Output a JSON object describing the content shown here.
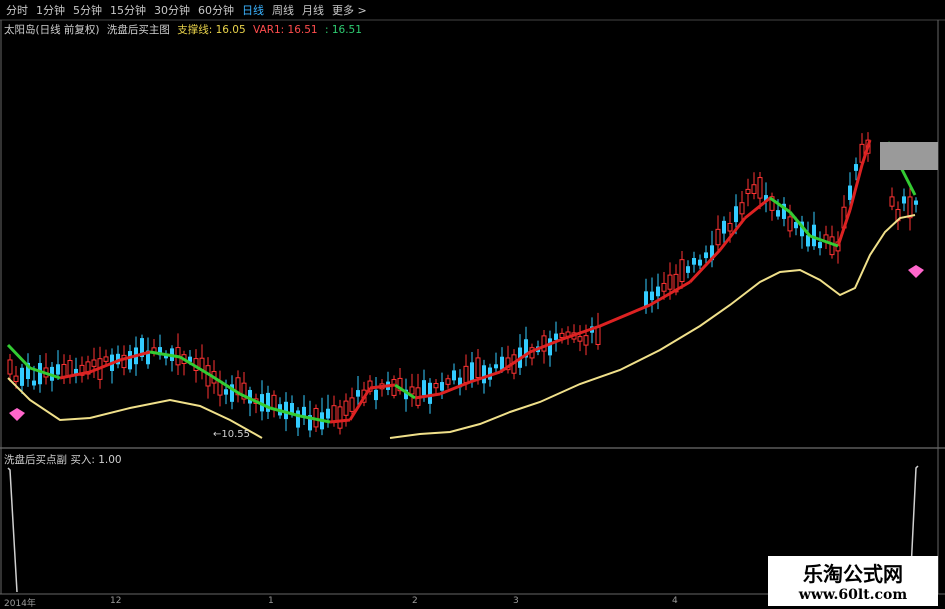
{
  "tabs": [
    "分时",
    "1分钟",
    "5分钟",
    "15分钟",
    "30分钟",
    "60分钟",
    "日线",
    "周线",
    "月线",
    "更多 >"
  ],
  "active_tab": "日线",
  "info": {
    "title": "太阳岛(日线 前复权)",
    "indicator": "洗盘后买主图",
    "support_label": "支撑线: 16.05",
    "var1_label": "VAR1: 16.51",
    "var_value": ": 16.51"
  },
  "price_annotation": "←10.55",
  "sub_indicator": {
    "label": "洗盘后买点副",
    "buy_label": "买入: 1.00"
  },
  "x_axis": {
    "labels": [
      "2014年",
      "12",
      "1",
      "2",
      "3",
      "4"
    ]
  },
  "watermark": {
    "line1": "乐淘公式网",
    "line2": "www.60lt.com"
  },
  "colors": {
    "background": "#000000",
    "up": "#ff3333",
    "down": "#33ccff",
    "ma_up": "#dd2222",
    "ma_down": "#33cc33",
    "support": "#f0e08a",
    "active_tab": "#3bb3ff"
  }
}
